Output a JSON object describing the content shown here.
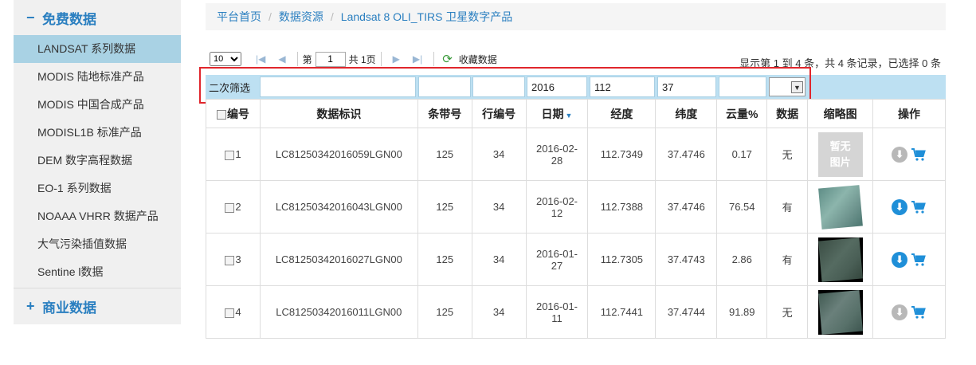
{
  "sidebar": {
    "free_header": "免费数据",
    "free_sign": "−",
    "items": [
      {
        "label": "LANDSAT 系列数据",
        "active": true
      },
      {
        "label": "MODIS 陆地标准产品"
      },
      {
        "label": "MODIS 中国合成产品"
      },
      {
        "label": "MODISL1B 标准产品"
      },
      {
        "label": "DEM 数字高程数据"
      },
      {
        "label": "EO-1 系列数据"
      },
      {
        "label": "NOAAA VHRR 数据产品"
      },
      {
        "label": "大气污染插值数据"
      },
      {
        "label": "Sentine l数据"
      }
    ],
    "commercial_header": "商业数据",
    "commercial_sign": "+"
  },
  "breadcrumb": {
    "home": "平台首页",
    "resources": "数据资源",
    "current": "Landsat 8 OLI_TIRS 卫星数字产品"
  },
  "pager": {
    "page_size": "10",
    "page_prefix": "第",
    "page_value": "1",
    "page_total": "共 1页",
    "favorite": "收藏数据",
    "summary": "显示第 1 到 4 条，共 4 条记录，已选择 0 条"
  },
  "filter": {
    "label": "二次筛选",
    "identifier": "",
    "path": "",
    "row": "",
    "date": "2016",
    "longitude": "112",
    "latitude": "37",
    "cloud": "",
    "data_option": ""
  },
  "table": {
    "headers": {
      "num": "编号",
      "id": "数据标识",
      "path": "条带号",
      "row": "行编号",
      "date": "日期",
      "lon": "经度",
      "lat": "纬度",
      "cloud": "云量%",
      "data": "数据",
      "thumb": "缩略图",
      "ops": "操作"
    },
    "rows": [
      {
        "num": "1",
        "id": "LC81250342016059LGN00",
        "path": "125",
        "row": "34",
        "date1": "2016-02-",
        "date2": "28",
        "lon": "112.7349",
        "lat": "37.4746",
        "cloud": "0.17",
        "data": "无",
        "thumb_line1": "暂无",
        "thumb_line2": "图片",
        "download_enabled": false
      },
      {
        "num": "2",
        "id": "LC81250342016043LGN00",
        "path": "125",
        "row": "34",
        "date1": "2016-02-",
        "date2": "12",
        "lon": "112.7388",
        "lat": "37.4746",
        "cloud": "76.54",
        "data": "有",
        "download_enabled": true
      },
      {
        "num": "3",
        "id": "LC81250342016027LGN00",
        "path": "125",
        "row": "34",
        "date1": "2016-01-",
        "date2": "27",
        "lon": "112.7305",
        "lat": "37.4743",
        "cloud": "2.86",
        "data": "有",
        "download_enabled": true
      },
      {
        "num": "4",
        "id": "LC81250342016011LGN00",
        "path": "125",
        "row": "34",
        "date1": "2016-01-",
        "date2": "11",
        "lon": "112.7441",
        "lat": "37.4744",
        "cloud": "91.89",
        "data": "无",
        "download_enabled": false
      }
    ]
  },
  "colors": {
    "accent": "#2a7fc0",
    "sidebar_active": "#a9d2e4",
    "filter_bar": "#bde0f2",
    "highlight": "#e0262c"
  },
  "icons": {
    "download": "download-circle-icon",
    "cart": "shopping-cart-icon",
    "refresh": "refresh-icon"
  }
}
